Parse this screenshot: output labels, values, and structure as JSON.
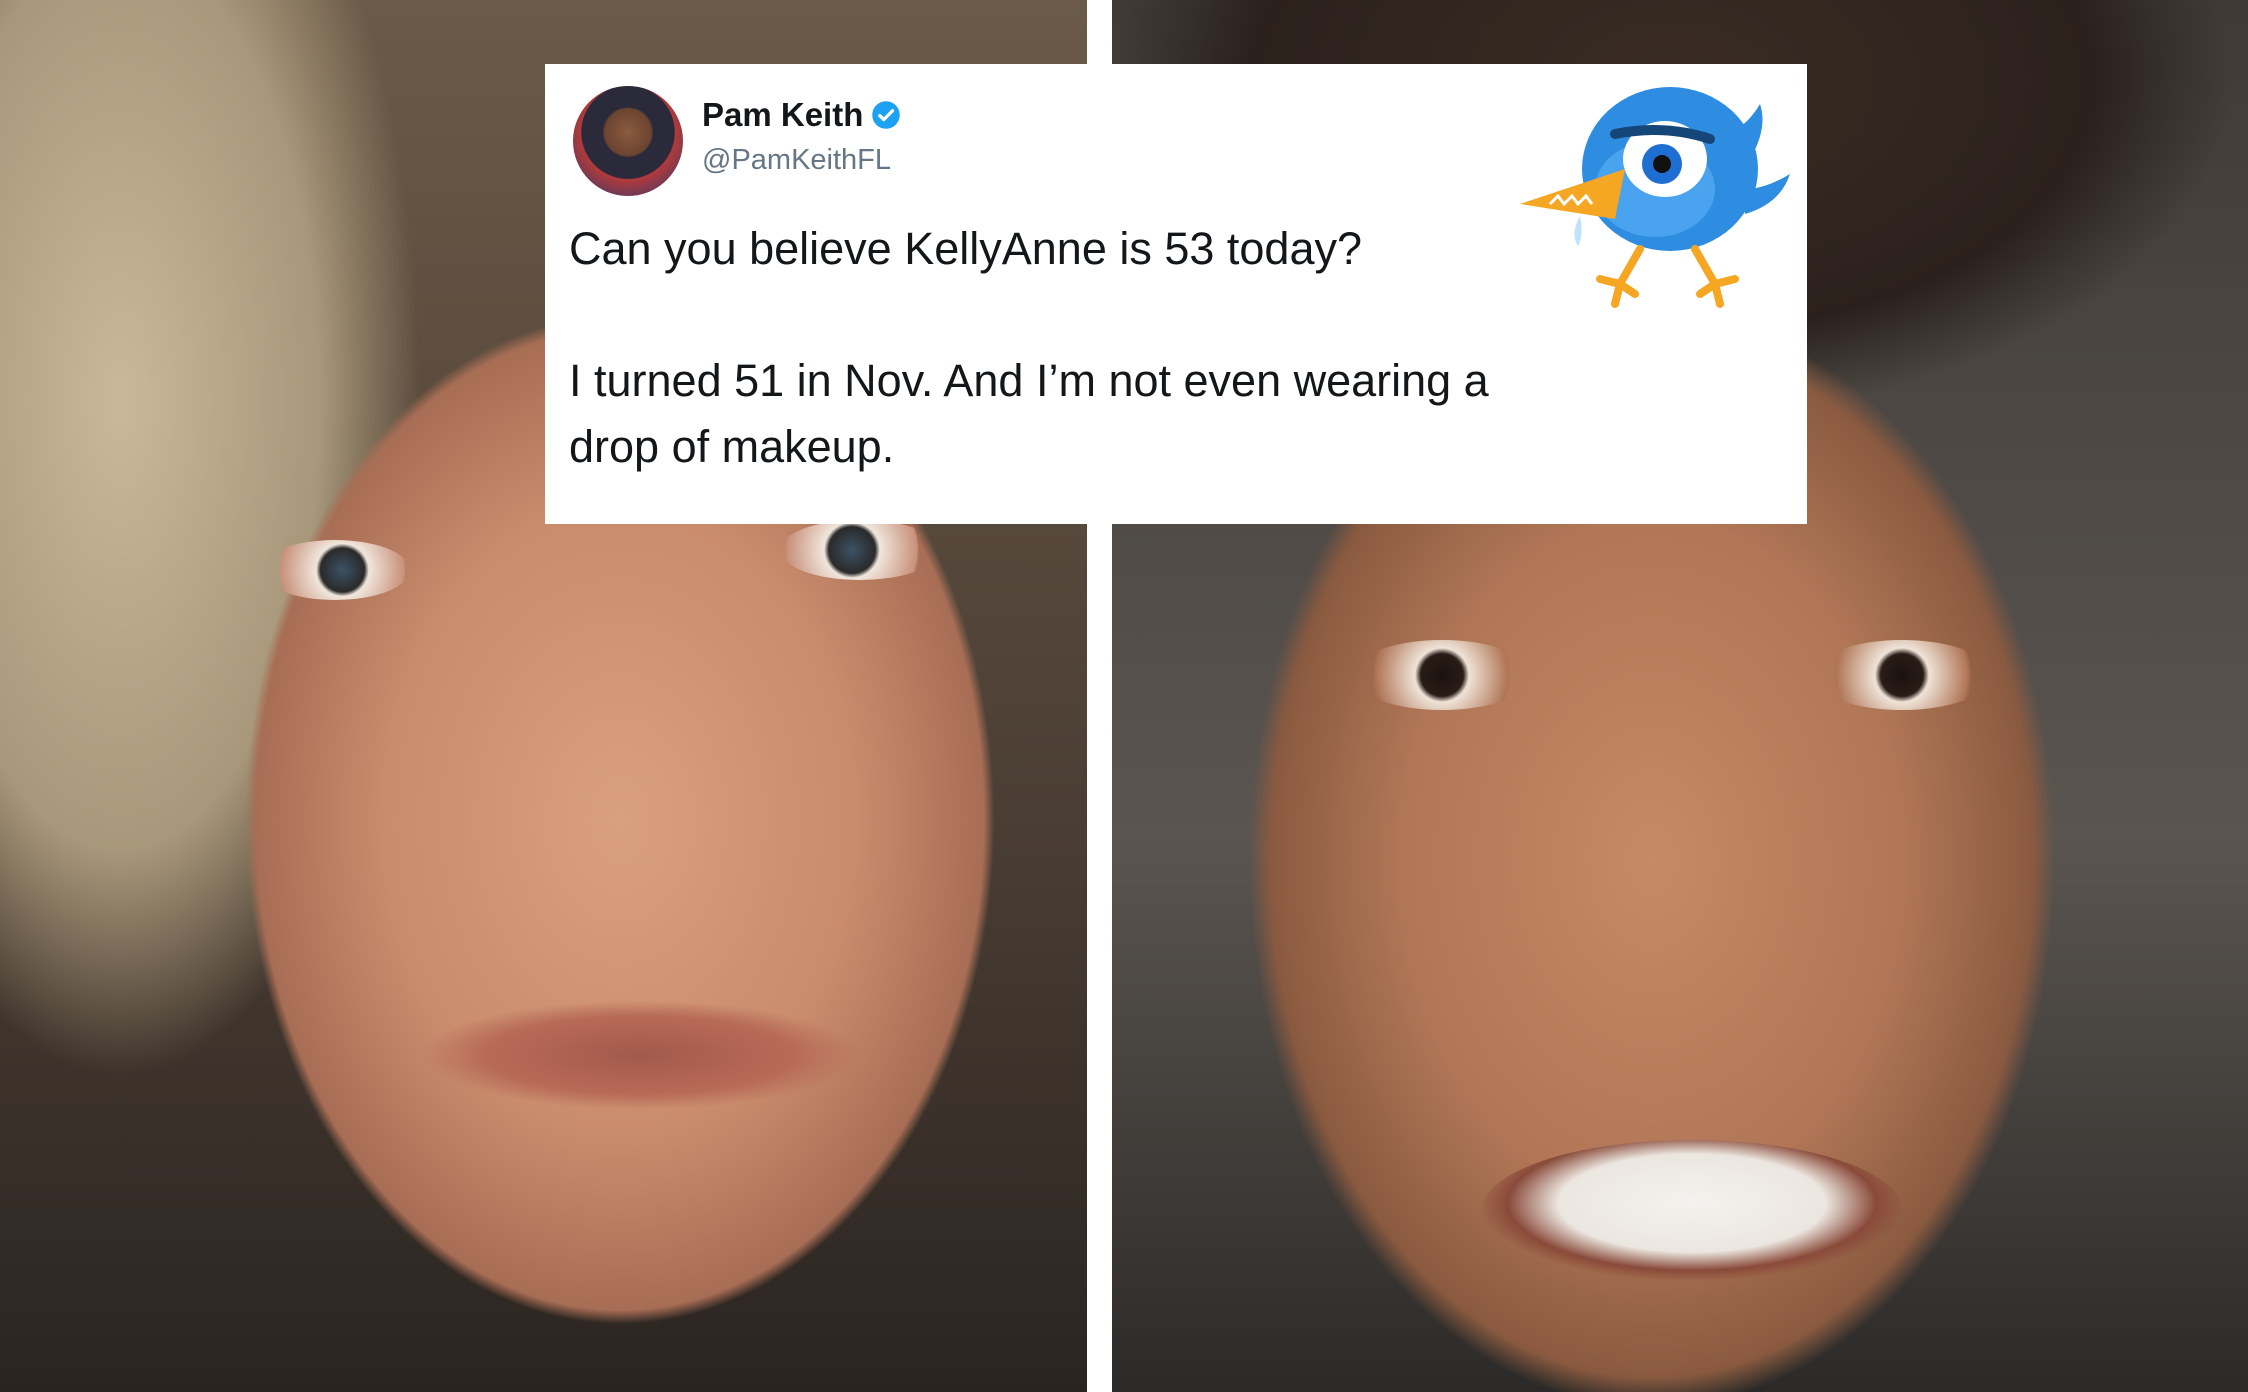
{
  "tweet": {
    "display_name": "Pam Keith",
    "handle": "@PamKeithFL",
    "text_line_1": "Can you believe KellyAnne is 53 today?",
    "text_line_2": "I turned 51 in Nov.  And I’m not even wearing a drop of makeup."
  },
  "colors": {
    "verified_badge": "#1da1f2",
    "bird_body": "#2e8de0",
    "bird_beak": "#f5a623"
  },
  "icons": {
    "verified": "verified-badge-icon",
    "mascot": "angry-bird-mascot-icon"
  }
}
